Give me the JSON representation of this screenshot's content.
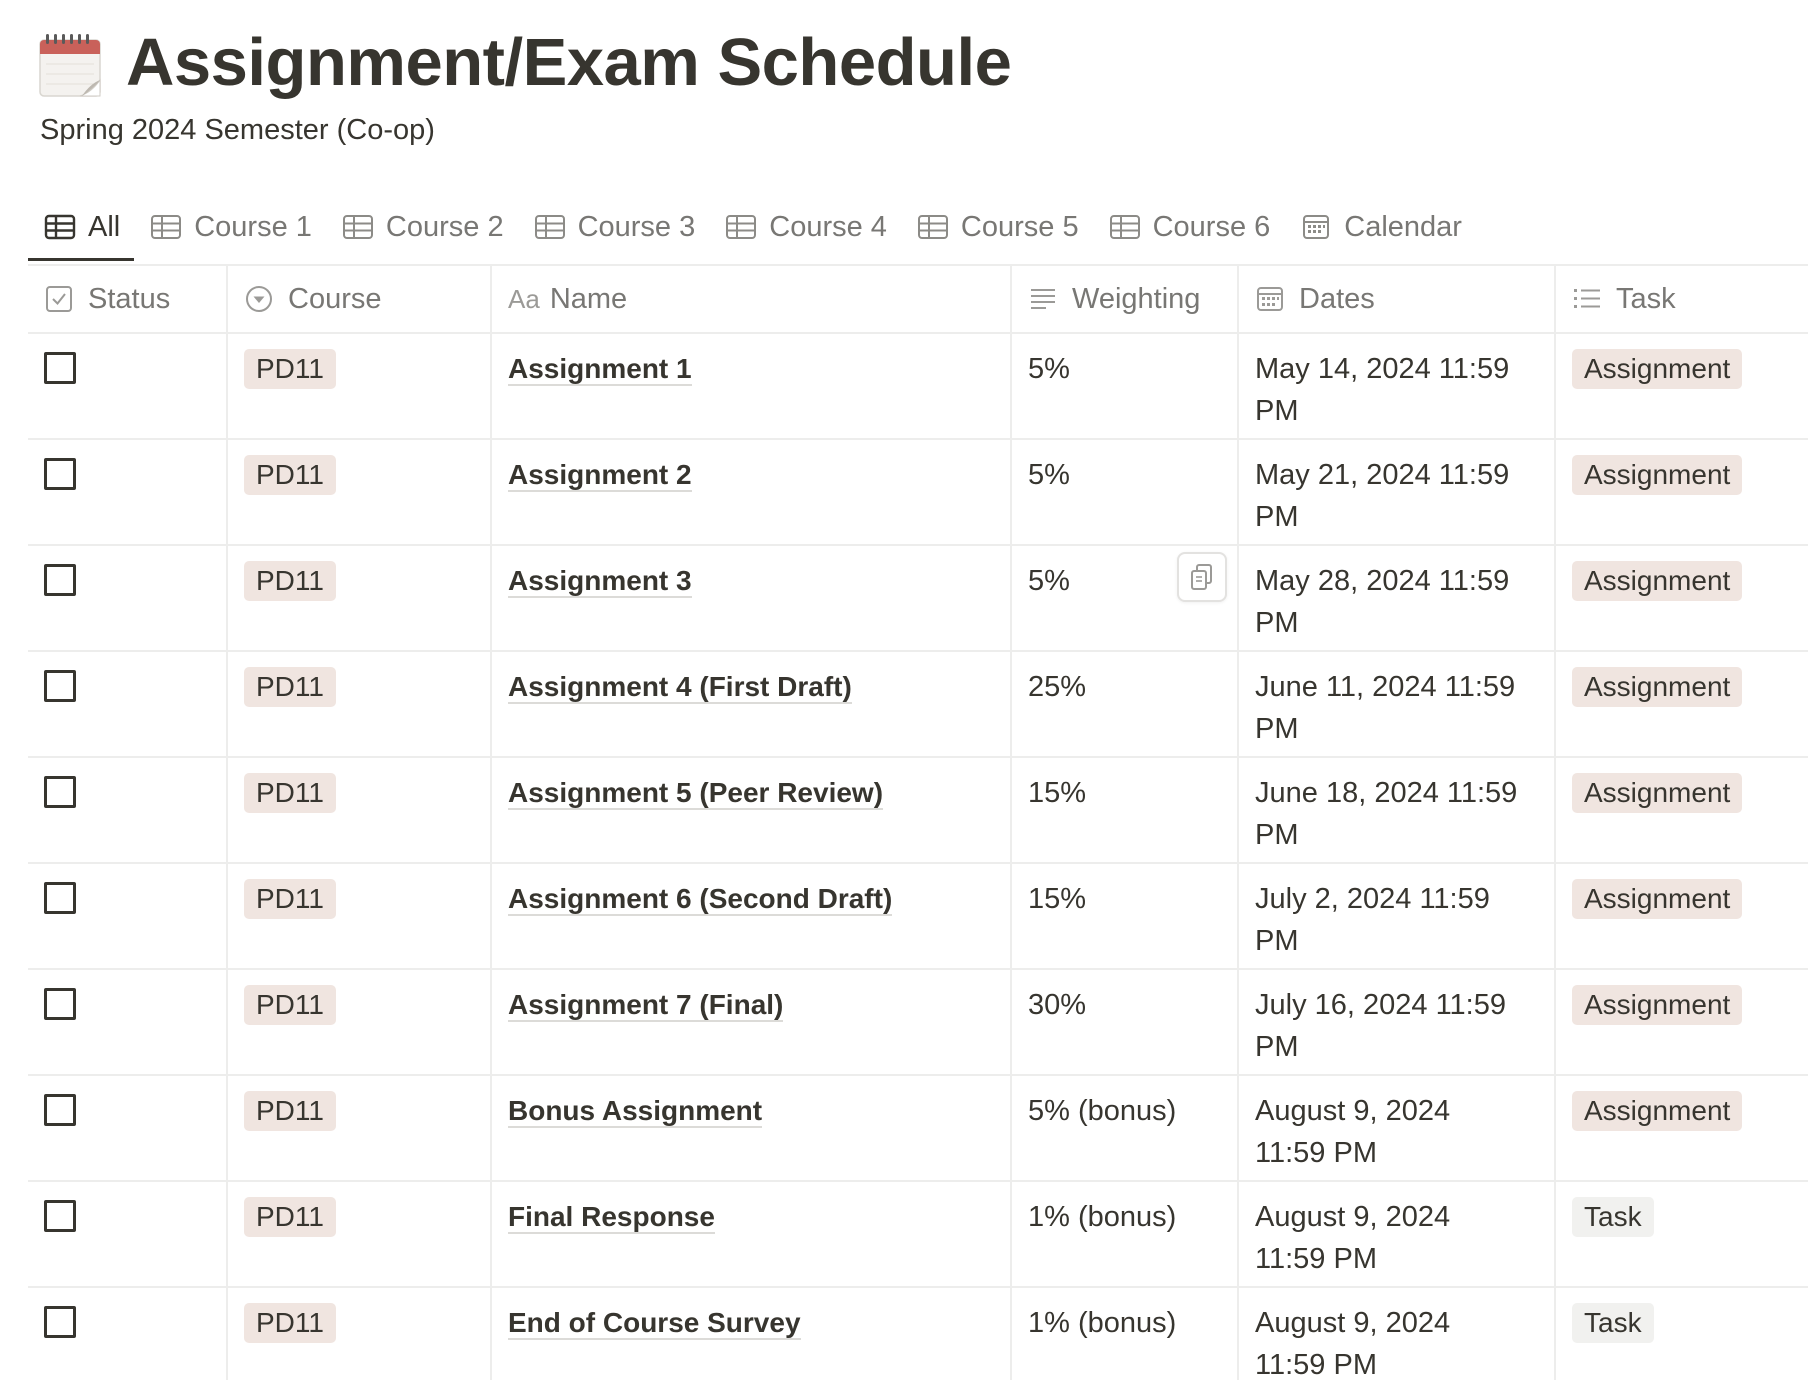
{
  "page": {
    "icon": "calendar-icon",
    "title": "Assignment/Exam Schedule",
    "subtitle": "Spring 2024 Semester (Co-op)"
  },
  "tabs": [
    {
      "label": "All",
      "icon": "table-icon",
      "active": true
    },
    {
      "label": "Course 1",
      "icon": "table-icon"
    },
    {
      "label": "Course 2",
      "icon": "table-icon"
    },
    {
      "label": "Course 3",
      "icon": "table-icon"
    },
    {
      "label": "Course 4",
      "icon": "table-icon"
    },
    {
      "label": "Course 5",
      "icon": "table-icon"
    },
    {
      "label": "Course 6",
      "icon": "table-icon"
    },
    {
      "label": "Calendar",
      "icon": "calendar-view-icon"
    }
  ],
  "columns": [
    {
      "label": "Status",
      "icon": "checkbox-icon"
    },
    {
      "label": "Course",
      "icon": "select-icon"
    },
    {
      "label": "Name",
      "icon": "text-aa-icon",
      "icon_text": "Aa"
    },
    {
      "label": "Weighting",
      "icon": "text-lines-icon"
    },
    {
      "label": "Dates",
      "icon": "date-icon"
    },
    {
      "label": "Task",
      "icon": "list-icon"
    }
  ],
  "rows": [
    {
      "course": "PD11",
      "name": "Assignment 1",
      "weighting": "5%",
      "date_line1": "May 14, 2024 11:59",
      "date_line2": "PM",
      "task": "Assignment",
      "task_type": "assignment"
    },
    {
      "course": "PD11",
      "name": "Assignment 2",
      "weighting": "5%",
      "date_line1": "May 21, 2024 11:59",
      "date_line2": "PM",
      "task": "Assignment",
      "task_type": "assignment"
    },
    {
      "course": "PD11",
      "name": "Assignment 3",
      "weighting": "5%",
      "date_line1": "May 28, 2024 11:59",
      "date_line2": "PM",
      "task": "Assignment",
      "task_type": "assignment",
      "show_copy": true
    },
    {
      "course": "PD11",
      "name": "Assignment 4 (First Draft)",
      "weighting": "25%",
      "date_line1": "June 11, 2024 11:59",
      "date_line2": "PM",
      "task": "Assignment",
      "task_type": "assignment"
    },
    {
      "course": "PD11",
      "name": "Assignment 5 (Peer Review)",
      "weighting": "15%",
      "date_line1": "June 18, 2024 11:59",
      "date_line2": "PM",
      "task": "Assignment",
      "task_type": "assignment"
    },
    {
      "course": "PD11",
      "name": "Assignment 6 (Second Draft)",
      "weighting": "15%",
      "date_line1": "July 2, 2024 11:59",
      "date_line2": "PM",
      "task": "Assignment",
      "task_type": "assignment"
    },
    {
      "course": "PD11",
      "name": "Assignment 7 (Final)",
      "weighting": "30%",
      "date_line1": "July 16, 2024 11:59",
      "date_line2": "PM",
      "task": "Assignment",
      "task_type": "assignment"
    },
    {
      "course": "PD11",
      "name": "Bonus Assignment",
      "weighting": "5% (bonus)",
      "date_line1": "August 9, 2024",
      "date_line2": "11:59 PM",
      "task": "Assignment",
      "task_type": "assignment"
    },
    {
      "course": "PD11",
      "name": "Final Response",
      "weighting": "1% (bonus)",
      "date_line1": "August 9, 2024",
      "date_line2": "11:59 PM",
      "task": "Task",
      "task_type": "task"
    },
    {
      "course": "PD11",
      "name": "End of Course Survey",
      "weighting": "1% (bonus)",
      "date_line1": "August 9, 2024",
      "date_line2": "11:59 PM",
      "task": "Task",
      "task_type": "task"
    }
  ],
  "colors": {
    "text": "#37352f",
    "muted": "#787774",
    "tag_course_bg": "#f0e5e0",
    "tag_task_bg": "#f1f1ef",
    "border": "#ededec"
  }
}
